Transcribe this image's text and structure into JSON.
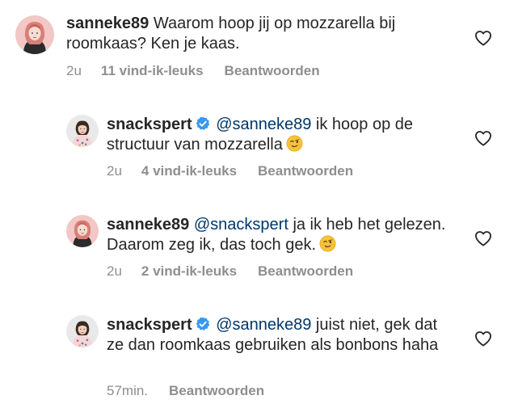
{
  "comments": [
    {
      "username": "sanneke89",
      "verified": false,
      "mention": "",
      "text": "Waarom hoop jij op mozzarella bij roomkaas? Ken je kaas.",
      "emoji": "",
      "time": "2u",
      "likes": "11 vind-ik-leuks",
      "reply_label": "Beantwoorden"
    },
    {
      "username": "snackspert",
      "verified": true,
      "mention": "@sanneke89",
      "text": "ik hoop op de structuur van mozzarella",
      "emoji": "wink-emoji",
      "time": "2u",
      "likes": "4 vind-ik-leuks",
      "reply_label": "Beantwoorden"
    },
    {
      "username": "sanneke89",
      "verified": false,
      "mention": "@snackspert",
      "text": "ja ik heb het gelezen. Daarom zeg ik, das toch gek.",
      "emoji": "wink-emoji",
      "time": "2u",
      "likes": "2 vind-ik-leuks",
      "reply_label": "Beantwoorden"
    },
    {
      "username": "snackspert",
      "verified": true,
      "mention": "@sanneke89",
      "text": "juist niet, gek dat ze dan roomkaas gebruiken als bonbons haha",
      "emoji": "",
      "time": "57min.",
      "likes": "",
      "reply_label": "Beantwoorden"
    }
  ],
  "colors": {
    "text": "#262626",
    "secondary": "#8e8e8e",
    "mention": "#00376b",
    "verified": "#3897f0"
  },
  "icons": {
    "like": "heart-outline-icon",
    "verified": "verified-badge-icon"
  }
}
